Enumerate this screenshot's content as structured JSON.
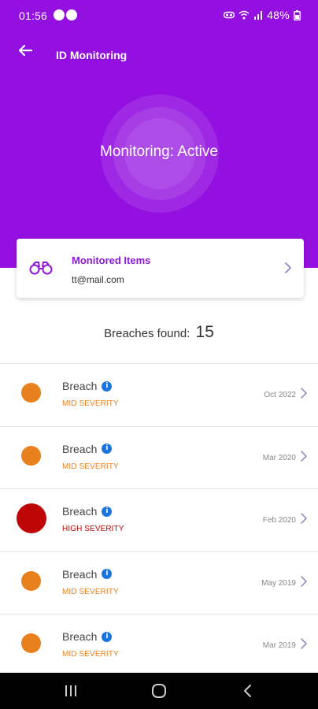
{
  "status_bar": {
    "time": "01:56",
    "battery": "48%",
    "notification_icons": [
      "app-notification-icon",
      "app-notification-icon"
    ],
    "right_icons": [
      "vpn-icon",
      "wifi-icon",
      "signal-icon",
      "battery-icon"
    ]
  },
  "app_bar": {
    "title": "ID Monitoring",
    "back_icon": "arrow-left-icon"
  },
  "monitoring": {
    "status": "Monitoring: Active"
  },
  "monitored_items": {
    "title": "Monitored Items",
    "email": "tt@mail.com",
    "icon": "binoculars-icon"
  },
  "breaches": {
    "label": "Breaches found:",
    "count": "15",
    "items": [
      {
        "name": "Breach",
        "severity": "MID SEVERITY",
        "date": "Oct 2022"
      },
      {
        "name": "Breach",
        "severity": "MID SEVERITY",
        "date": "Mar 2020"
      },
      {
        "name": "Breach",
        "severity": "HIGH SEVERITY",
        "date": "Feb 2020"
      },
      {
        "name": "Breach",
        "severity": "MID SEVERITY",
        "date": "May 2019"
      },
      {
        "name": "Breach",
        "severity": "MID SEVERITY",
        "date": "Mar 2019"
      }
    ]
  },
  "colors": {
    "header": "#9410e0",
    "accent": "#8f19d6",
    "mid_severity": "#e8811d",
    "high_severity": "#bf0606",
    "info": "#1b74e0"
  },
  "nav_bar": {
    "icons": [
      "recents-icon",
      "home-icon",
      "back-icon"
    ]
  }
}
